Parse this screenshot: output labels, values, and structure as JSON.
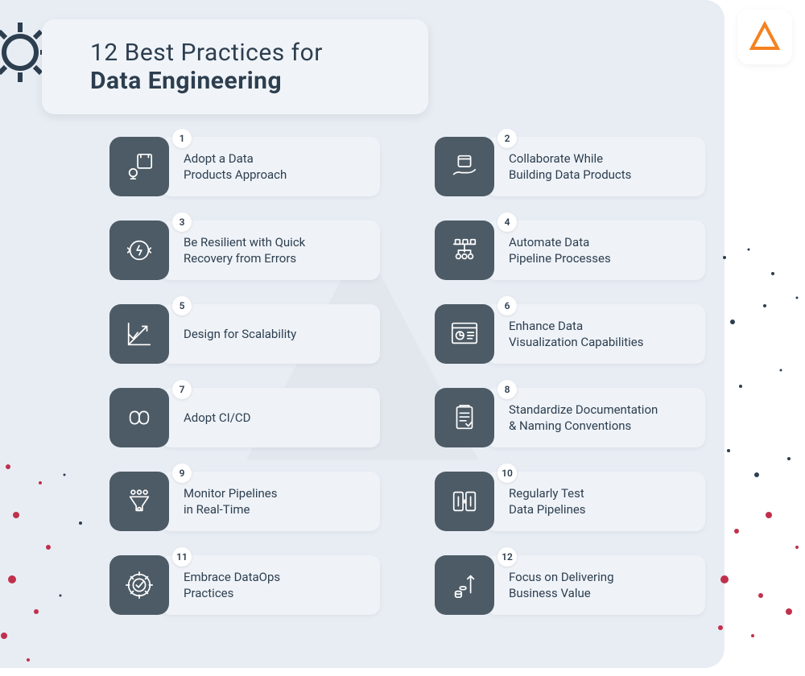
{
  "title": {
    "line1": "12 Best Practices for",
    "line2": "Data Engineering"
  },
  "colors": {
    "background": "#e8edf4",
    "card_bg": "#eff3f8",
    "title_card_bg": "#f0f4f9",
    "icon_tile": "#4d5b66",
    "text": "#2d3e4f",
    "accent": "#F58220"
  },
  "items": [
    {
      "num": "1",
      "label": "Adopt a Data\nProducts Approach",
      "icon": "lightbulb-box-icon"
    },
    {
      "num": "2",
      "label": "Collaborate While\nBuilding Data Products",
      "icon": "hand-offer-icon"
    },
    {
      "num": "3",
      "label": "Be Resilient with Quick\nRecovery from Errors",
      "icon": "recovery-cycle-icon"
    },
    {
      "num": "4",
      "label": "Automate Data\nPipeline Processes",
      "icon": "pipeline-nodes-icon"
    },
    {
      "num": "5",
      "label": "Design for Scalability",
      "icon": "scale-chart-icon"
    },
    {
      "num": "6",
      "label": "Enhance Data\nVisualization Capabilities",
      "icon": "dashboard-icon"
    },
    {
      "num": "7",
      "label": "Adopt CI/CD",
      "icon": "infinity-icon"
    },
    {
      "num": "8",
      "label": "Standardize Documentation\n& Naming Conventions",
      "icon": "document-check-icon"
    },
    {
      "num": "9",
      "label": "Monitor Pipelines\nin Real-Time",
      "icon": "funnel-users-icon"
    },
    {
      "num": "10",
      "label": "Regularly Test\nData Pipelines",
      "icon": "test-flow-icon"
    },
    {
      "num": "11",
      "label": "Embrace DataOps\nPractices",
      "icon": "gear-check-icon"
    },
    {
      "num": "12",
      "label": "Focus on Delivering\nBusiness Value",
      "icon": "coins-growth-icon"
    }
  ]
}
